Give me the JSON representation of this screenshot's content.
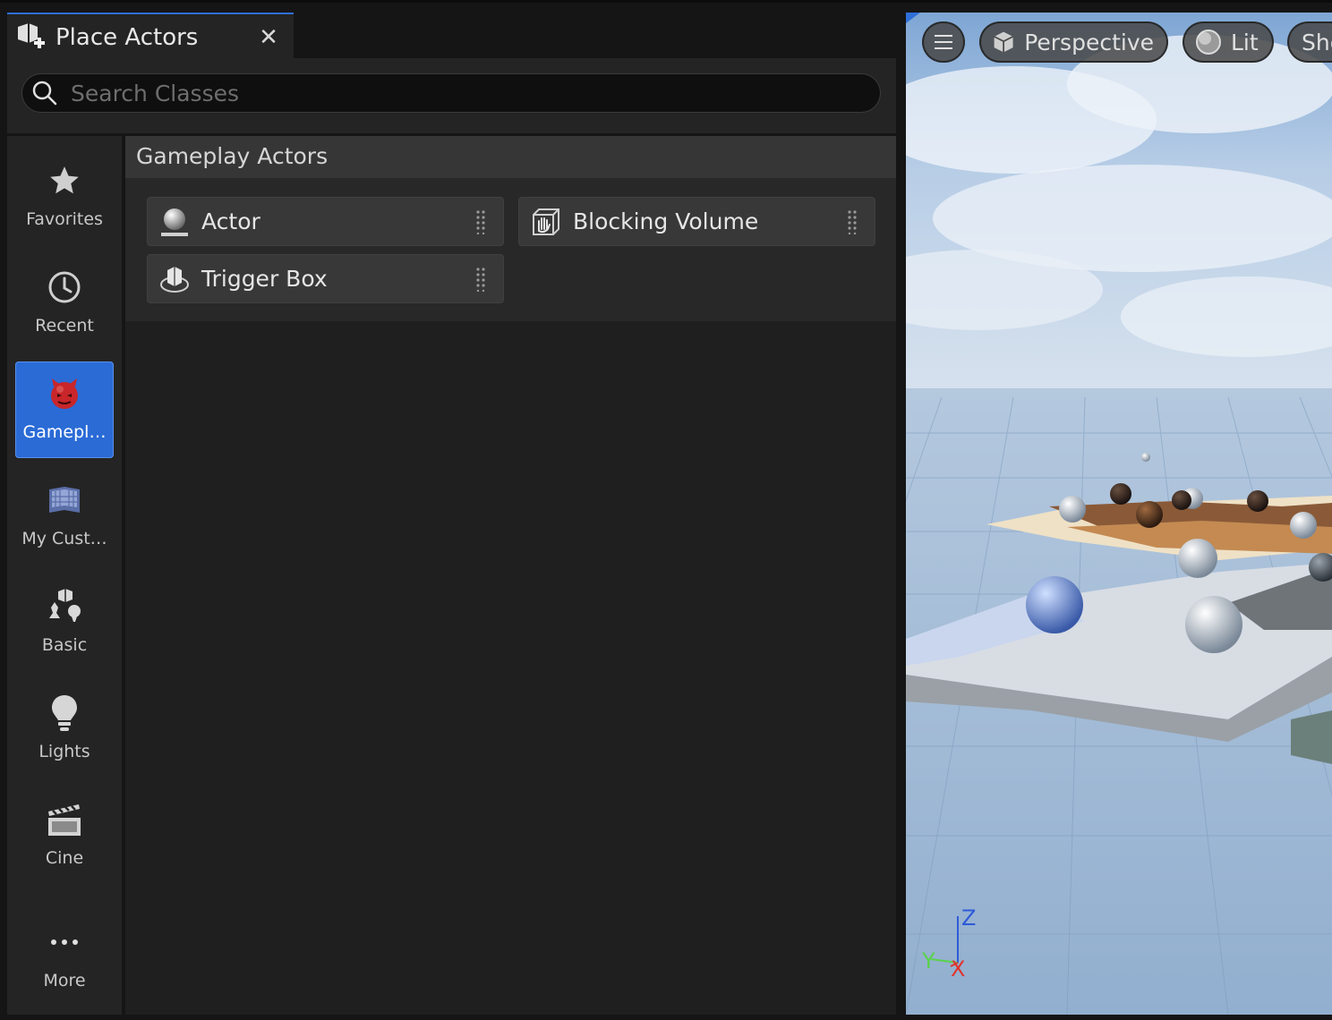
{
  "tab": {
    "title": "Place Actors",
    "close": "✕"
  },
  "search": {
    "placeholder": "Search Classes",
    "value": ""
  },
  "sidebar": {
    "categories": [
      {
        "label": "Favorites",
        "icon": "star-icon",
        "active": false
      },
      {
        "label": "Recent",
        "icon": "clock-icon",
        "active": false
      },
      {
        "label": "Gamepl…",
        "icon": "gameplay-icon",
        "active": true
      },
      {
        "label": "My Cust…",
        "icon": "custom-icon",
        "active": false
      },
      {
        "label": "Basic",
        "icon": "basic-icon",
        "active": false
      },
      {
        "label": "Lights",
        "icon": "lightbulb-icon",
        "active": false
      },
      {
        "label": "Cine",
        "icon": "clapperboard-icon",
        "active": false
      },
      {
        "label": "More",
        "icon": "more-icon",
        "active": false
      }
    ]
  },
  "section": {
    "title": "Gameplay Actors"
  },
  "items": [
    {
      "label": "Actor",
      "icon": "actor-sphere-icon"
    },
    {
      "label": "Blocking Volume",
      "icon": "blocking-volume-icon"
    },
    {
      "label": "Trigger Box",
      "icon": "trigger-box-icon"
    }
  ],
  "viewport": {
    "buttons": [
      {
        "label": "",
        "icon": "hamburger-menu-icon"
      },
      {
        "label": "Perspective",
        "icon": "perspective-cube-icon"
      },
      {
        "label": "Lit",
        "icon": "lit-sphere-icon"
      },
      {
        "label": "Sho",
        "icon": ""
      }
    ],
    "axes": {
      "z": "Z",
      "y": "Y",
      "x": "X"
    }
  },
  "colors": {
    "accent": "#2a6bd6",
    "panel": "#242424",
    "content": "#1f1f1f",
    "sky": "#a9c4e2",
    "axis_x": "#e0332c",
    "axis_y": "#5ad24a",
    "axis_z": "#2e5ad8"
  }
}
